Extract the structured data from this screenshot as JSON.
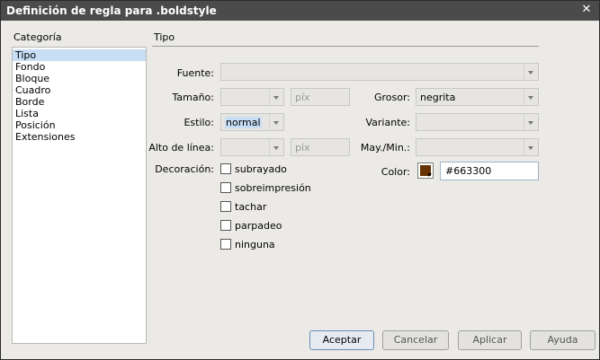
{
  "dialog": {
    "title": "Definición de regla para .boldstyle",
    "close_glyph": "✕"
  },
  "category": {
    "label": "Categoría",
    "items": [
      "Tipo",
      "Fondo",
      "Bloque",
      "Cuadro",
      "Borde",
      "Lista",
      "Posición",
      "Extensiones"
    ],
    "selected": "Tipo"
  },
  "section_title": "Tipo",
  "fields": {
    "fuente": {
      "label": "Fuente:",
      "value": ""
    },
    "tamano": {
      "label": "Tamaño:",
      "value": "",
      "unit": "píx"
    },
    "grosor": {
      "label": "Grosor:",
      "value": "negrita"
    },
    "estilo": {
      "label": "Estilo:",
      "value": "normal"
    },
    "variante": {
      "label": "Variante:",
      "value": ""
    },
    "alto_linea": {
      "label": "Alto de línea:",
      "value": "",
      "unit": "píx"
    },
    "may_min": {
      "label": "May./Min.:",
      "value": ""
    },
    "decoracion": {
      "label": "Decoración:",
      "options": [
        {
          "label": "subrayado",
          "checked": false
        },
        {
          "label": "sobreimpresión",
          "checked": false
        },
        {
          "label": "tachar",
          "checked": false
        },
        {
          "label": "parpadeo",
          "checked": false
        },
        {
          "label": "ninguna",
          "checked": false
        }
      ]
    },
    "color": {
      "label": "Color:",
      "value": "#663300",
      "swatch": "#663300"
    }
  },
  "buttons": {
    "accept": "Aceptar",
    "cancel": "Cancelar",
    "apply": "Aplicar",
    "help": "Ayuda"
  }
}
